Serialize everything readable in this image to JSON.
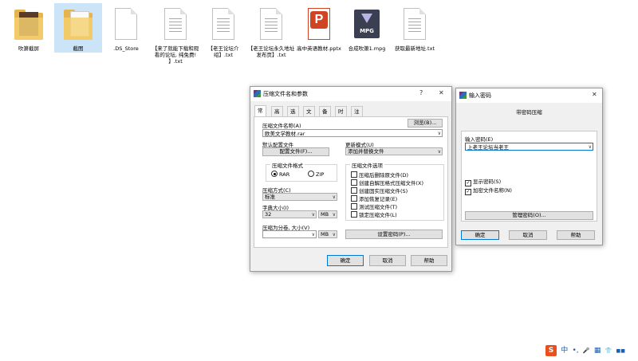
{
  "desktop": {
    "files": [
      {
        "label": "吹箫截屏"
      },
      {
        "label": "截图"
      },
      {
        "label": ".DS_Store"
      },
      {
        "label": "【来了就能下载和观看的论坛, 纯免费! 】.txt"
      },
      {
        "label": "【老王论坛介绍】.txt"
      },
      {
        "label": "【老王论坛永久地址发布页】.txt"
      },
      {
        "label": "高中英语教材.pptx"
      },
      {
        "label": "合成吹箫1.mpg"
      },
      {
        "label": "获取最新地址.txt"
      }
    ],
    "ppt_glyph": "P",
    "mpg_badge": "MPG"
  },
  "archive_dialog": {
    "title": "压缩文件名和参数",
    "help": "?",
    "close": "✕",
    "tabs": [
      "常规",
      "高级",
      "选项",
      "文件",
      "备份",
      "时间",
      "注释"
    ],
    "filename_label": "压缩文件名称(A)",
    "browse_button": "浏览(B)...",
    "filename_value": "欧美文学教材.rar",
    "profile_label": "默认配置文件",
    "profile_button": "配置文件(F)...",
    "update_mode_label": "更新模式(U)",
    "update_mode_value": "添加并替换文件",
    "format_label": "压缩文件格式",
    "format_rar": "RAR",
    "format_zip": "ZIP",
    "options_label": "压缩文件选项",
    "options": [
      {
        "label": "压缩后删除原文件(D)",
        "checked": false
      },
      {
        "label": "创建自解压格式压缩文件(X)",
        "checked": false
      },
      {
        "label": "创建固实压缩文件(S)",
        "checked": false
      },
      {
        "label": "添加恢复记录(E)",
        "checked": false
      },
      {
        "label": "测试压缩文件(T)",
        "checked": false
      },
      {
        "label": "锁定压缩文件(L)",
        "checked": false
      }
    ],
    "method_label": "压缩方式(C)",
    "method_value": "标准",
    "dict_label": "字典大小(I)",
    "dict_value": "32",
    "dict_unit": "MB",
    "split_label": "压缩为分卷, 大小(V)",
    "split_unit": "MB",
    "password_button": "设置密码(P)...",
    "ok_button": "确定",
    "cancel_button": "取消",
    "help_button": "帮助"
  },
  "password_dialog": {
    "title": "输入密码",
    "close": "✕",
    "header": "带密码压缩",
    "prompt_label": "输入密码(E)",
    "password_value": "上老王论坛当老王",
    "show_password": "显示密码(S)",
    "encrypt_names": "加密文件名称(N)",
    "manage_button": "管理密码(O)...",
    "ok_button": "确定",
    "cancel_button": "取消",
    "help_button": "帮助"
  },
  "tray": {
    "ime_logo": "S",
    "ime_mode": "中",
    "items": [
      "•,",
      "🎤",
      "▦",
      "👕",
      "■■"
    ]
  },
  "colors": {
    "accent": "#0078d7",
    "ppt": "#d04423",
    "folder": "#e6b44c",
    "ime": "#e8501f"
  }
}
